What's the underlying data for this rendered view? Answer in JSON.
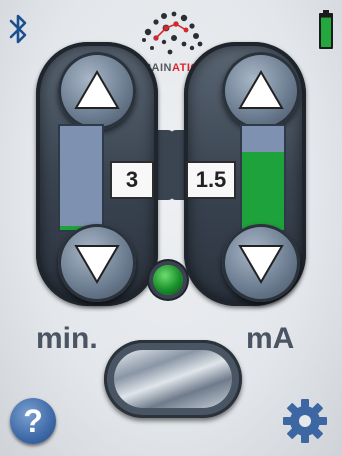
{
  "header": {
    "logo": {
      "prefix": "BRAIN",
      "suffix": "ATICA"
    },
    "bluetooth_icon": "bluetooth-icon",
    "battery_icon": "battery-icon",
    "battery_level": 0.95
  },
  "left_panel": {
    "unit_label": "min.",
    "value": "3",
    "fill_fraction": 0.04,
    "up_icon": "triangle-up-icon",
    "down_icon": "triangle-down-icon"
  },
  "right_panel": {
    "unit_label": "mA",
    "value": "1.5",
    "fill_fraction": 0.75,
    "up_icon": "triangle-up-icon",
    "down_icon": "triangle-down-icon"
  },
  "status_indicator": {
    "state": "on",
    "color": "#1fa83a"
  },
  "footer": {
    "help_label": "?",
    "settings_icon": "gear-icon"
  },
  "colors": {
    "accent_green": "#1ea23b",
    "bar_empty": "#7f91b0",
    "brand_red": "#d9262e",
    "help_blue": "#3f6aa8"
  }
}
